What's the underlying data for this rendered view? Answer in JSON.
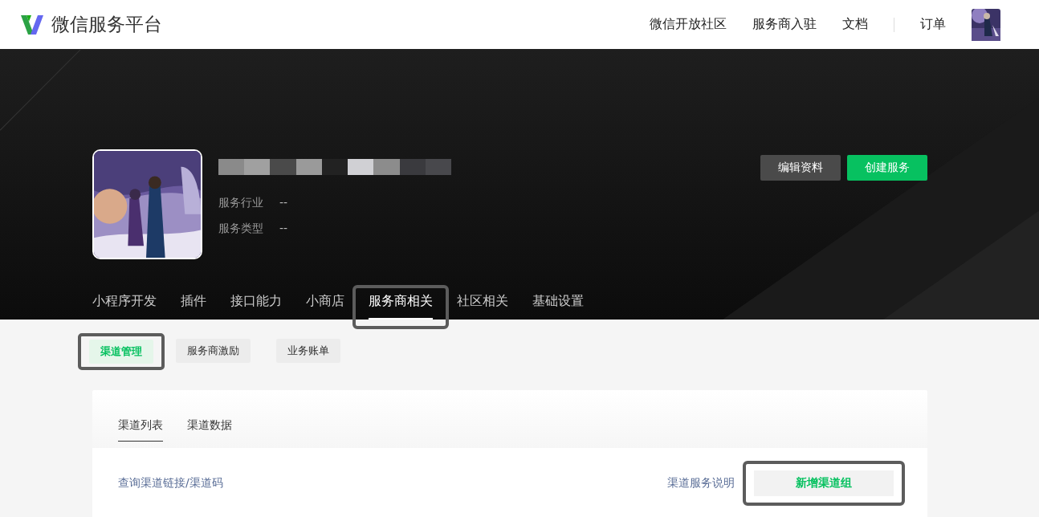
{
  "header": {
    "logo_text": "微信服务平台",
    "nav": [
      {
        "label": "微信开放社区"
      },
      {
        "label": "服务商入驻"
      },
      {
        "label": "文档"
      },
      {
        "label": "订单"
      }
    ]
  },
  "profile": {
    "fields": [
      {
        "label": "服务行业",
        "value": "--"
      },
      {
        "label": "服务类型",
        "value": "--"
      }
    ],
    "buttons": [
      {
        "label": "编辑资料",
        "kind": "secondary"
      },
      {
        "label": "创建服务",
        "kind": "primary"
      }
    ]
  },
  "main_tabs": [
    {
      "label": "小程序开发",
      "selected": false,
      "highlighted": false
    },
    {
      "label": "插件",
      "selected": false,
      "highlighted": false
    },
    {
      "label": "接口能力",
      "selected": false,
      "highlighted": false
    },
    {
      "label": "小商店",
      "selected": false,
      "highlighted": false
    },
    {
      "label": "服务商相关",
      "selected": true,
      "highlighted": true
    },
    {
      "label": "社区相关",
      "selected": false,
      "highlighted": false
    },
    {
      "label": "基础设置",
      "selected": false,
      "highlighted": false
    }
  ],
  "sub_tabs": [
    {
      "label": "渠道管理",
      "selected": true,
      "highlighted": true
    },
    {
      "label": "服务商激励",
      "selected": false,
      "highlighted": false
    },
    {
      "label": "业务账单",
      "selected": false,
      "highlighted": false
    }
  ],
  "card": {
    "tabs": [
      {
        "label": "渠道列表",
        "selected": true
      },
      {
        "label": "渠道数据",
        "selected": false
      }
    ],
    "query_link": "查询渠道链接/渠道码",
    "help_link": "渠道服务说明",
    "add_button": {
      "label": "新增渠道组",
      "highlighted": true
    }
  }
}
